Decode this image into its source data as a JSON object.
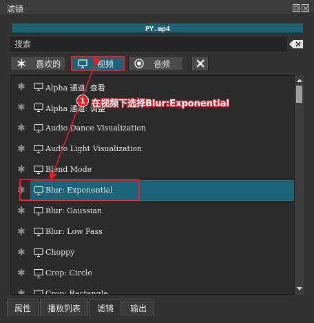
{
  "panel": {
    "title": "滤镜"
  },
  "clip": {
    "name": "PY.mp4"
  },
  "search": {
    "placeholder": "搜索",
    "value": ""
  },
  "categories": [
    {
      "label": "喜欢的",
      "icon": "star-icon"
    },
    {
      "label": "视频",
      "icon": "monitor-icon",
      "selected": true
    },
    {
      "label": "音频",
      "icon": "speaker-icon"
    }
  ],
  "filters": [
    "Alpha 通道: 查看",
    "Alpha 通道: 调整",
    "Audio Dance Visualization",
    "Audio Light Visualization",
    "Blend Mode",
    "Blur: Exponential",
    "Blur: Gaussian",
    "Blur: Low Pass",
    "Choppy",
    "Crop: Circle",
    "Crop: Rectangle"
  ],
  "selected_filter_index": 5,
  "annotation": {
    "number": "1",
    "text": "在视频下选择Blur:Exponential"
  },
  "bottom_tabs": [
    "属性",
    "播放列表",
    "滤镜",
    "输出"
  ],
  "colors": {
    "accent": "#1d6378",
    "highlight_red": "#e2202a",
    "background": "#323232"
  }
}
